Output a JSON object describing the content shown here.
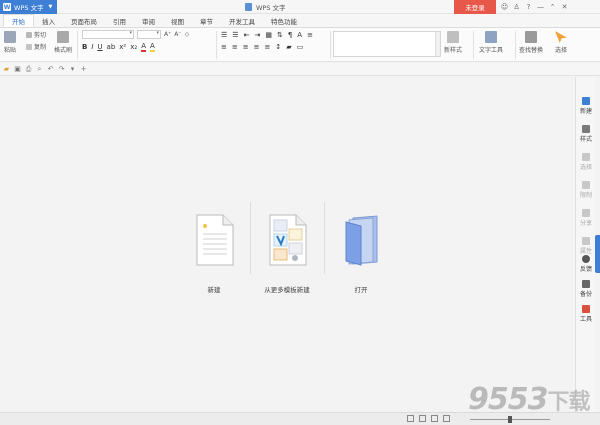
{
  "titlebar": {
    "app_name": "WPS 文字",
    "app_logo": "W",
    "window_title": "WPS 文字",
    "login": "未登录",
    "icons": [
      "skin-icon",
      "shirt-icon",
      "help-icon",
      "minimize-icon",
      "restore-icon",
      "close-icon"
    ],
    "icon_glyphs": [
      "☺",
      "♙",
      "?",
      "—",
      "⌃",
      "✕"
    ]
  },
  "tabs": [
    "开始",
    "插入",
    "页面布局",
    "引用",
    "审阅",
    "视图",
    "章节",
    "开发工具",
    "特色功能"
  ],
  "ribbon": {
    "paste": "粘贴",
    "cut": "剪切",
    "copy": "复制",
    "format_painter": "格式刷",
    "new_style": "新样式",
    "text_tools": "文字工具",
    "find_replace": "查找替换",
    "select": "选择"
  },
  "main": {
    "new_label": "新建",
    "template_label": "从更多模板新建",
    "open_label": "打开"
  },
  "sidebar": {
    "items": [
      {
        "label": "新建",
        "dim": false
      },
      {
        "label": "样式",
        "dim": false
      },
      {
        "label": "选择",
        "dim": true
      },
      {
        "label": "限制",
        "dim": true
      },
      {
        "label": "分享",
        "dim": true
      },
      {
        "label": "属性",
        "dim": true
      },
      {
        "label": "反馈",
        "dim": false
      },
      {
        "label": "备份",
        "dim": false
      },
      {
        "label": "工具",
        "dim": false
      }
    ]
  },
  "watermark": {
    "text": "9553",
    "suffix": "下载"
  },
  "colors": {
    "accent": "#3d7fd4",
    "login": "#e8584a",
    "folder": "#7c9fe6"
  }
}
